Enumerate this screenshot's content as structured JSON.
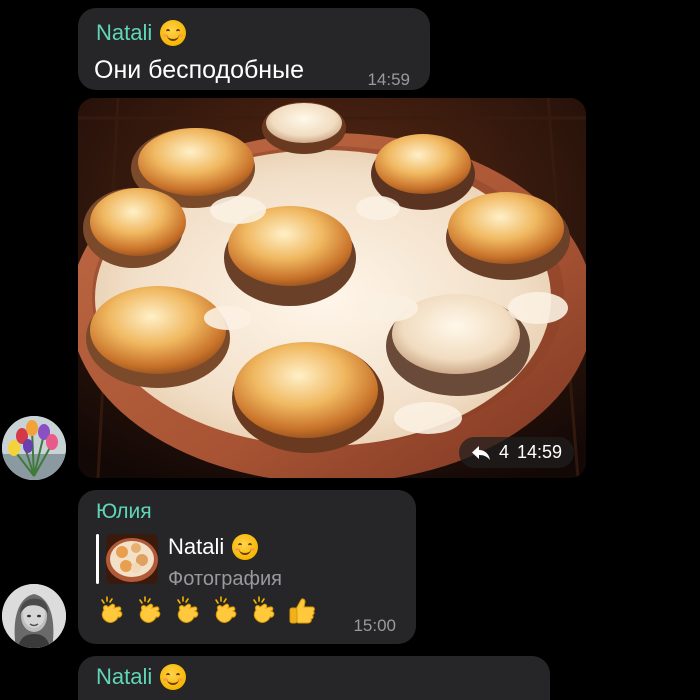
{
  "messages": [
    {
      "sender": "Natali",
      "sender_emoji": "smiling-face-icon",
      "text": "Они бесподобные",
      "time": "14:59"
    },
    {
      "type": "photo",
      "subject": "baked mushrooms with cheese in clay dish",
      "replies": "4",
      "time": "14:59"
    },
    {
      "sender": "Юлия",
      "reply_to": {
        "name": "Natali",
        "kind": "Фотография"
      },
      "emojis": [
        "clapping-hands-icon",
        "clapping-hands-icon",
        "clapping-hands-icon",
        "clapping-hands-icon",
        "clapping-hands-icon",
        "thumbs-up-icon"
      ],
      "time": "15:00"
    },
    {
      "sender": "Natali",
      "sender_emoji": "smiling-face-icon"
    }
  ],
  "colors": {
    "background": "#000000",
    "bubble": "#262628",
    "sender_name": "#5fd6b8",
    "time": "#9a9a9e"
  }
}
